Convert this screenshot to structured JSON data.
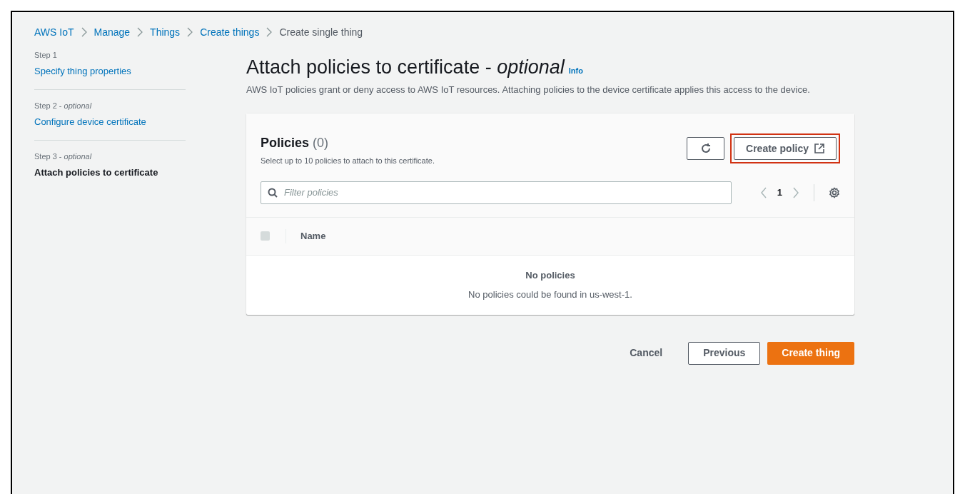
{
  "breadcrumbs": [
    {
      "label": "AWS IoT",
      "link": true
    },
    {
      "label": "Manage",
      "link": true
    },
    {
      "label": "Things",
      "link": true
    },
    {
      "label": "Create things",
      "link": true
    },
    {
      "label": "Create single thing",
      "link": false
    }
  ],
  "steps": [
    {
      "step": "Step 1",
      "label": "Specify thing properties",
      "selected": false
    },
    {
      "step": "Step 2 - *optional*",
      "label": "Configure device certificate",
      "selected": false
    },
    {
      "step": "Step 3 - *optional*",
      "label": "Attach policies to certificate",
      "selected": true
    }
  ],
  "page": {
    "title": "Attach policies to certificate - ",
    "title_suffix": "optional",
    "info": "Info",
    "description": "AWS IoT policies grant or deny access to AWS IoT resources. Attaching policies to the device certificate applies this access to the device."
  },
  "policies": {
    "title": "Policies",
    "count": "(0)",
    "subtitle": "Select up to 10 policies to attach to this certificate.",
    "create_button": {
      "label": "Create policy",
      "highlighted": true
    },
    "filter": {
      "placeholder": "Filter policies"
    },
    "page_number": "1",
    "header_checkbox": {
      "disabled": true
    },
    "columns": [
      "Name"
    ],
    "empty_title": "No policies",
    "empty_text": "No policies could be found in us-west-1."
  },
  "buttons": [
    {
      "label": "Cancel",
      "kind": "link"
    },
    {
      "label": "Previous",
      "kind": "normal"
    },
    {
      "label": "Create thing",
      "kind": "primary"
    }
  ]
}
